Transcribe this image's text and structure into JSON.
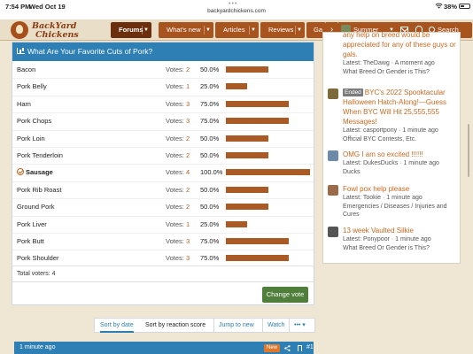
{
  "status_bar": {
    "time": "7:54 PM",
    "date": "Wed Oct 19",
    "url": "backyardchickens.com",
    "dots": "•••",
    "battery": "38%"
  },
  "site": {
    "logo_line1": "BackYard",
    "logo_line2": "Chickens"
  },
  "nav": {
    "tabs": [
      {
        "label": "Forums"
      },
      {
        "label": "What's new"
      },
      {
        "label": "Articles"
      },
      {
        "label": "Reviews"
      },
      {
        "label": "Ga"
      }
    ],
    "overflow": "›",
    "username": "Summer_",
    "search": "Search"
  },
  "poll": {
    "title": "What Are Your Favorite Cuts of Pork?",
    "votes_label": "Votes:",
    "options": [
      {
        "name": "Bacon",
        "votes": "2",
        "percent": "50.0%",
        "fraction": 0.5
      },
      {
        "name": "Pork Belly",
        "votes": "1",
        "percent": "25.0%",
        "fraction": 0.25
      },
      {
        "name": "Ham",
        "votes": "3",
        "percent": "75.0%",
        "fraction": 0.75
      },
      {
        "name": "Pork Chops",
        "votes": "3",
        "percent": "75.0%",
        "fraction": 0.75
      },
      {
        "name": "Pork Loin",
        "votes": "2",
        "percent": "50.0%",
        "fraction": 0.5
      },
      {
        "name": "Pork Tenderloin",
        "votes": "2",
        "percent": "50.0%",
        "fraction": 0.5
      },
      {
        "name": "Sausage",
        "votes": "4",
        "percent": "100.0%",
        "fraction": 1.0,
        "selected": true
      },
      {
        "name": "Pork Rib Roast",
        "votes": "2",
        "percent": "50.0%",
        "fraction": 0.5
      },
      {
        "name": "Ground Pork",
        "votes": "2",
        "percent": "50.0%",
        "fraction": 0.5
      },
      {
        "name": "Pork Liver",
        "votes": "1",
        "percent": "25.0%",
        "fraction": 0.25
      },
      {
        "name": "Pork Butt",
        "votes": "3",
        "percent": "75.0%",
        "fraction": 0.75
      },
      {
        "name": "Pork Shoulder",
        "votes": "3",
        "percent": "75.0%",
        "fraction": 0.75
      }
    ],
    "total": "Total voters: 4",
    "change_vote": "Change vote",
    "colors": {
      "header": "#2d7fb4",
      "bar": "#a95a25",
      "button": "#4f7f3a"
    }
  },
  "sort_bar": {
    "by_date": "Sort by date",
    "by_reaction": "Sort by reaction score",
    "jump_new": "Jump to new",
    "watch": "Watch",
    "more": "••• ▾"
  },
  "post": {
    "time": "1 minute ago",
    "badge": "New",
    "number": "#1"
  },
  "sidebar": {
    "items": [
      {
        "tag": "",
        "title_lines": [
          "any help on breed would be",
          "appreciated for any of these guys or",
          "gals."
        ],
        "latest": "Latest: TheDawg · A moment ago",
        "forum": "What Breed Or Gender is This?",
        "thumb_color": "#ffffff"
      },
      {
        "tag": "Ended",
        "title_lines": [
          "BYC's 2022 Spooktacular",
          "Halloween Hatch-Along!—Guess",
          "When BYC Will Hit 25,555,555",
          "Messages!"
        ],
        "latest": "Latest: casportpony · 1 minute ago",
        "forum": "Official BYC Contests, Etc.",
        "thumb_color": "#7c6a3a"
      },
      {
        "tag": "",
        "title_lines": [
          "OMG I am so excited !!!!!!"
        ],
        "latest": "Latest: DukesDucks · 1 minute ago",
        "forum": "Ducks",
        "thumb_color": "#6d8aa6"
      },
      {
        "tag": "",
        "title_lines": [
          "Fowl pox help please"
        ],
        "latest": "Latest: Tookie · 1 minute ago",
        "forum": "Emergencies / Diseases / Injuries and Cures",
        "thumb_color": "#9a6b4a"
      },
      {
        "tag": "",
        "title_lines": [
          "13 week Vaulted Silkie"
        ],
        "latest": "Latest: Ponypoor · 1 minute ago",
        "forum": "What Breed Or Gender is This?",
        "thumb_color": "#555555"
      }
    ]
  }
}
